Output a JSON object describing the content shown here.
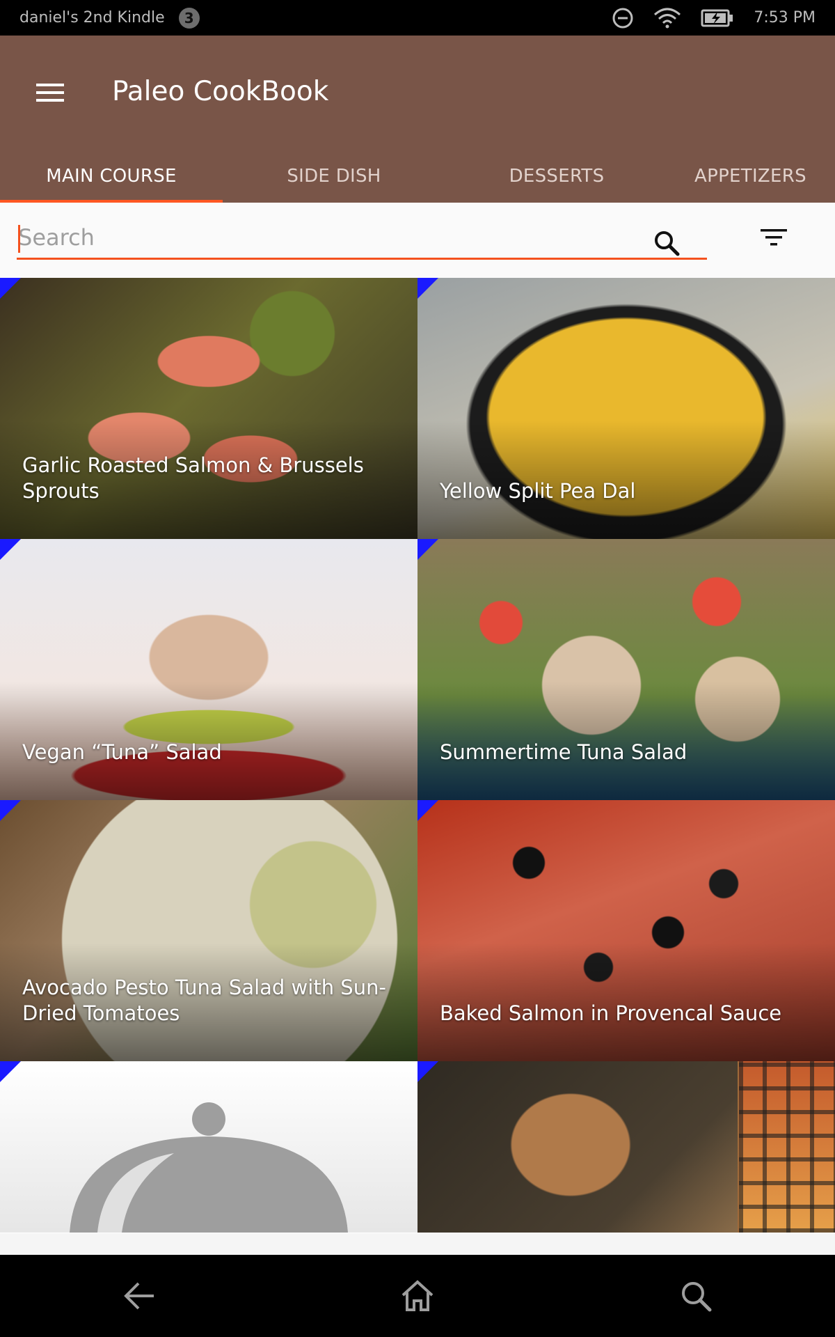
{
  "status_bar": {
    "device_name": "daniel's 2nd Kindle",
    "notification_count": "3",
    "time": "7:53 PM",
    "icons": [
      "do-not-disturb-icon",
      "wifi-icon",
      "battery-charging-icon"
    ]
  },
  "app": {
    "title": "Paleo CookBook",
    "menu_icon": "hamburger-menu-icon",
    "brand_color": "#795548",
    "accent_color": "#ff5722"
  },
  "tabs": [
    {
      "label": "MAIN COURSE",
      "active": true
    },
    {
      "label": "SIDE DISH",
      "active": false
    },
    {
      "label": "DESSERTS",
      "active": false
    },
    {
      "label": "APPETIZERS",
      "active": false
    }
  ],
  "search": {
    "placeholder": "Search",
    "value": "",
    "search_icon": "search-icon",
    "filter_icon": "filter-icon"
  },
  "recipes": [
    {
      "title": "Garlic Roasted Salmon & Brussels Sprouts"
    },
    {
      "title": "Yellow Split Pea Dal"
    },
    {
      "title": "Vegan “Tuna” Salad"
    },
    {
      "title": "Summertime Tuna Salad"
    },
    {
      "title": "Avocado Pesto Tuna Salad with Sun-Dried Tomatoes"
    },
    {
      "title": "Baked Salmon in Provencal Sauce"
    },
    {
      "title": ""
    },
    {
      "title": ""
    }
  ],
  "nav_bar": {
    "buttons": [
      "back-icon",
      "home-icon",
      "search-icon"
    ]
  }
}
